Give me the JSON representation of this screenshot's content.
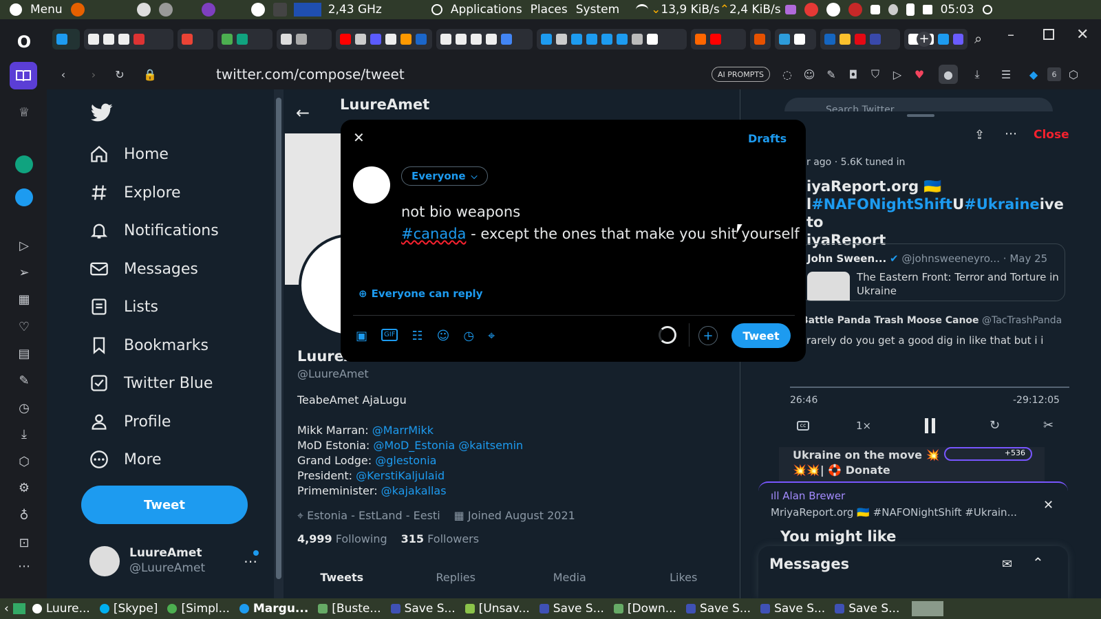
{
  "os_panel": {
    "menu_label": "Menu",
    "cpu_freq": "2,43 GHz",
    "applications": "Applications",
    "places": "Places",
    "system": "System",
    "net_down": "13,9 KiB/s",
    "net_up": "2,4 KiB/s",
    "clock": "05:03"
  },
  "browser": {
    "url": "twitter.com/compose/tweet",
    "ai_prompts_label": "AI PROMPTS",
    "badge_count": "6"
  },
  "twitter": {
    "nav": [
      {
        "label": "Home",
        "icon": "home-icon"
      },
      {
        "label": "Explore",
        "icon": "hashtag-icon"
      },
      {
        "label": "Notifications",
        "icon": "bell-icon"
      },
      {
        "label": "Messages",
        "icon": "mail-icon"
      },
      {
        "label": "Lists",
        "icon": "list-icon"
      },
      {
        "label": "Bookmarks",
        "icon": "bookmark-icon"
      },
      {
        "label": "Twitter Blue",
        "icon": "twitter-blue-icon"
      },
      {
        "label": "Profile",
        "icon": "person-icon"
      },
      {
        "label": "More",
        "icon": "more-circle-icon"
      }
    ],
    "tweet_button": "Tweet",
    "account": {
      "name": "LuureAmet",
      "handle": "@LuureAmet"
    },
    "profile": {
      "header_name": "LuureAmet",
      "name": "LuureAmet",
      "handle": "@LuureAmet",
      "bio": "TeabeAmet AjaLugu",
      "bio_lines": [
        {
          "label": "Mikk Marran:",
          "links": "@MarrMikk"
        },
        {
          "label": "MoD Estonia:",
          "links": "@MoD_Estonia @kaitsemin"
        },
        {
          "label": "Grand Lodge:",
          "links": "@glestonia"
        },
        {
          "label": "President:",
          "links": "@KerstiKaljulaid"
        },
        {
          "label": "Primeminister:",
          "links": "@kajakallas"
        }
      ],
      "location": "Estonia - EstLand - Eesti",
      "joined": "Joined August 2021",
      "following_count": "4,999",
      "following_label": "Following",
      "followers_count": "315",
      "followers_label": "Followers",
      "tabs": [
        "Tweets",
        "Replies",
        "Media",
        "Likes"
      ]
    },
    "space": {
      "close_label": "Close",
      "meta": "r ago · 5.6K tuned in",
      "title_line1": "iyaReport.org 🇺🇦",
      "title_line2_pre": "l",
      "hashtag1": "#NAFONightShift",
      "title_mid": "U",
      "hashtag2": "#Ukraine",
      "title_line2_post": "ive to",
      "title_line3": "iyaReport",
      "quoted": {
        "name": "John Sween...",
        "handle": "@johnsweeneyro...",
        "date": "May 25",
        "text": "The Eastern Front: Terror and Torture in Ukraine"
      },
      "reply": {
        "name": "Battle Panda Trash Moose Canoe",
        "handle": "@TacTrashPanda",
        "text": "rarely do you get a good dig in like that but i i"
      },
      "elapsed": "26:46",
      "remaining": "-29:12:05",
      "speed": "1×",
      "banner_text": "Ukraine on the move 💥",
      "banner_text2": "💥💥| 🛟 Donate",
      "avatar_count": "+536",
      "mini_host": "Alan Brewer",
      "mini_title": "MriyaReport.org 🇺🇦 #NAFONightShift #Ukrain...",
      "you_might_like": "You might like",
      "search_placeholder": "Search Twitter"
    },
    "messages_label": "Messages"
  },
  "compose": {
    "drafts_label": "Drafts",
    "audience_label": "Everyone",
    "text_line1": "not bio weapons",
    "hashtag": "#canada",
    "text_line2_rest": " - except the ones that make you shit yourself",
    "reply_setting": "Everyone can reply",
    "tweet_button": "Tweet"
  },
  "taskbar": {
    "tasks": [
      "Luure...",
      "[Skype]",
      "[Simpl...",
      "Margu...",
      "[Buste...",
      "Save S...",
      "[Unsav...",
      "Save S...",
      "[Down...",
      "Save S...",
      "Save S...",
      "Save S..."
    ]
  },
  "colors": {
    "accent": "#1d9bf0",
    "page_bg": "#15202b",
    "modal_bg": "#000000",
    "panel_bg": "#2f3a2a",
    "space_close": "#f4212e"
  }
}
